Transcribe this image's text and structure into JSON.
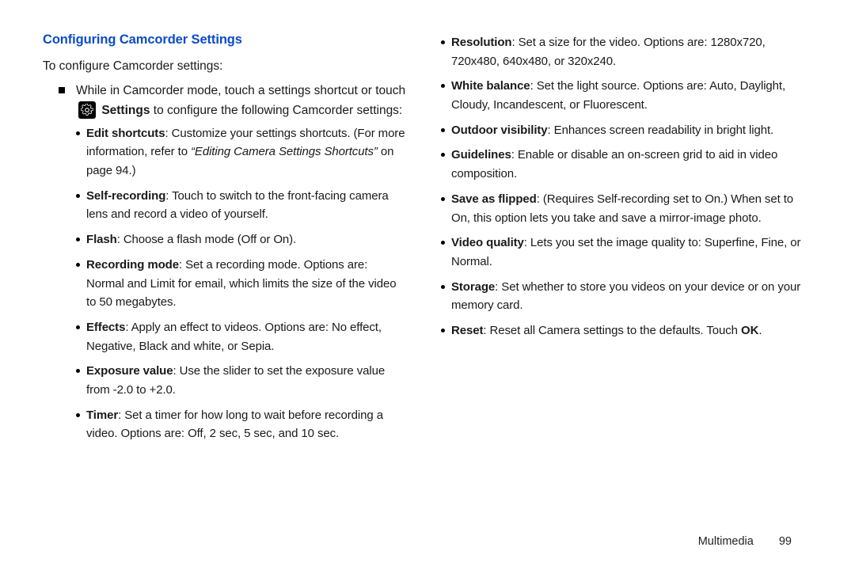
{
  "heading": "Configuring Camcorder Settings",
  "intro": "To configure Camcorder settings:",
  "step_a": "While in Camcorder mode, touch a settings shortcut or touch",
  "step_b_bold": "Settings",
  "step_b_rest": " to configure the following Camcorder settings:",
  "left": [
    {
      "t": "Edit shortcuts",
      "pre": ": Customize your settings shortcuts. (For more information, refer to ",
      "ital": "“Editing Camera Settings Shortcuts”",
      "post": " on page 94.)"
    },
    {
      "t": "Self-recording",
      "d": ": Touch to switch to the front-facing camera lens and record a video of yourself."
    },
    {
      "t": "Flash",
      "d": ": Choose a flash mode (Off or On)."
    },
    {
      "t": "Recording mode",
      "d": ": Set a recording mode. Options are: Normal and Limit for email, which limits the size of the video to 50 megabytes."
    },
    {
      "t": "Effects",
      "d": ": Apply an effect to videos. Options are: No effect, Negative, Black and white, or Sepia."
    },
    {
      "t": "Exposure value",
      "d": ": Use the slider to set the exposure value from -2.0 to +2.0."
    },
    {
      "t": "Timer",
      "d": ": Set a timer for how long to wait before recording a video. Options are: Off, 2 sec, 5 sec, and 10 sec."
    }
  ],
  "right": [
    {
      "t": "Resolution",
      "d": ": Set a size for the video. Options are: 1280x720, 720x480, 640x480, or 320x240."
    },
    {
      "t": "White balance",
      "d": ": Set the light source. Options are: Auto, Daylight, Cloudy, Incandescent, or Fluorescent."
    },
    {
      "t": "Outdoor visibility",
      "d": ": Enhances screen readability in bright light."
    },
    {
      "t": "Guidelines",
      "d": ": Enable or disable an on-screen grid to aid in video composition."
    },
    {
      "t": "Save as flipped",
      "d": ": (Requires Self-recording set to On.) When set to On, this option lets you take and save a mirror-image photo."
    },
    {
      "t": "Video quality",
      "d": ": Lets you set the image quality to: Superfine, Fine, or Normal."
    },
    {
      "t": "Storage",
      "d": ": Set whether to store you videos on your device or on your memory card."
    },
    {
      "t": "Reset",
      "d": ": Reset all Camera settings to the defaults. Touch ",
      "tail": "OK",
      "tailpost": "."
    }
  ],
  "footer_section": "Multimedia",
  "footer_page": "99"
}
